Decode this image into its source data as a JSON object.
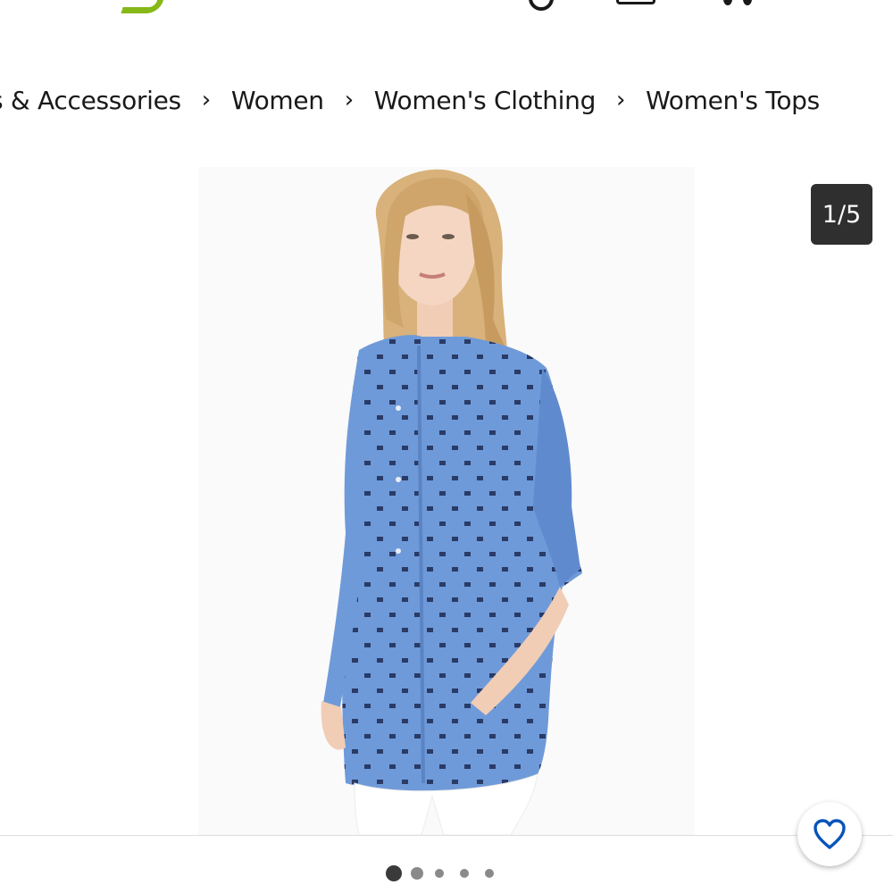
{
  "header": {
    "logo_icon": "ebay-logo-icon",
    "search_icon": "search-icon",
    "cart_icon": "cart-icon"
  },
  "breadcrumb": {
    "items": [
      {
        "label": "s & Accessories"
      },
      {
        "label": "Women"
      },
      {
        "label": "Women's Clothing"
      },
      {
        "label": "Women's Tops"
      }
    ],
    "separator_icon": "chevron-right-icon"
  },
  "gallery": {
    "counter": "1/5",
    "current_image": 1,
    "total_images": 5,
    "watch_icon": "heart-outline-icon",
    "accent_color": "#0654ba",
    "shirt_color": "#6f9ad9"
  }
}
